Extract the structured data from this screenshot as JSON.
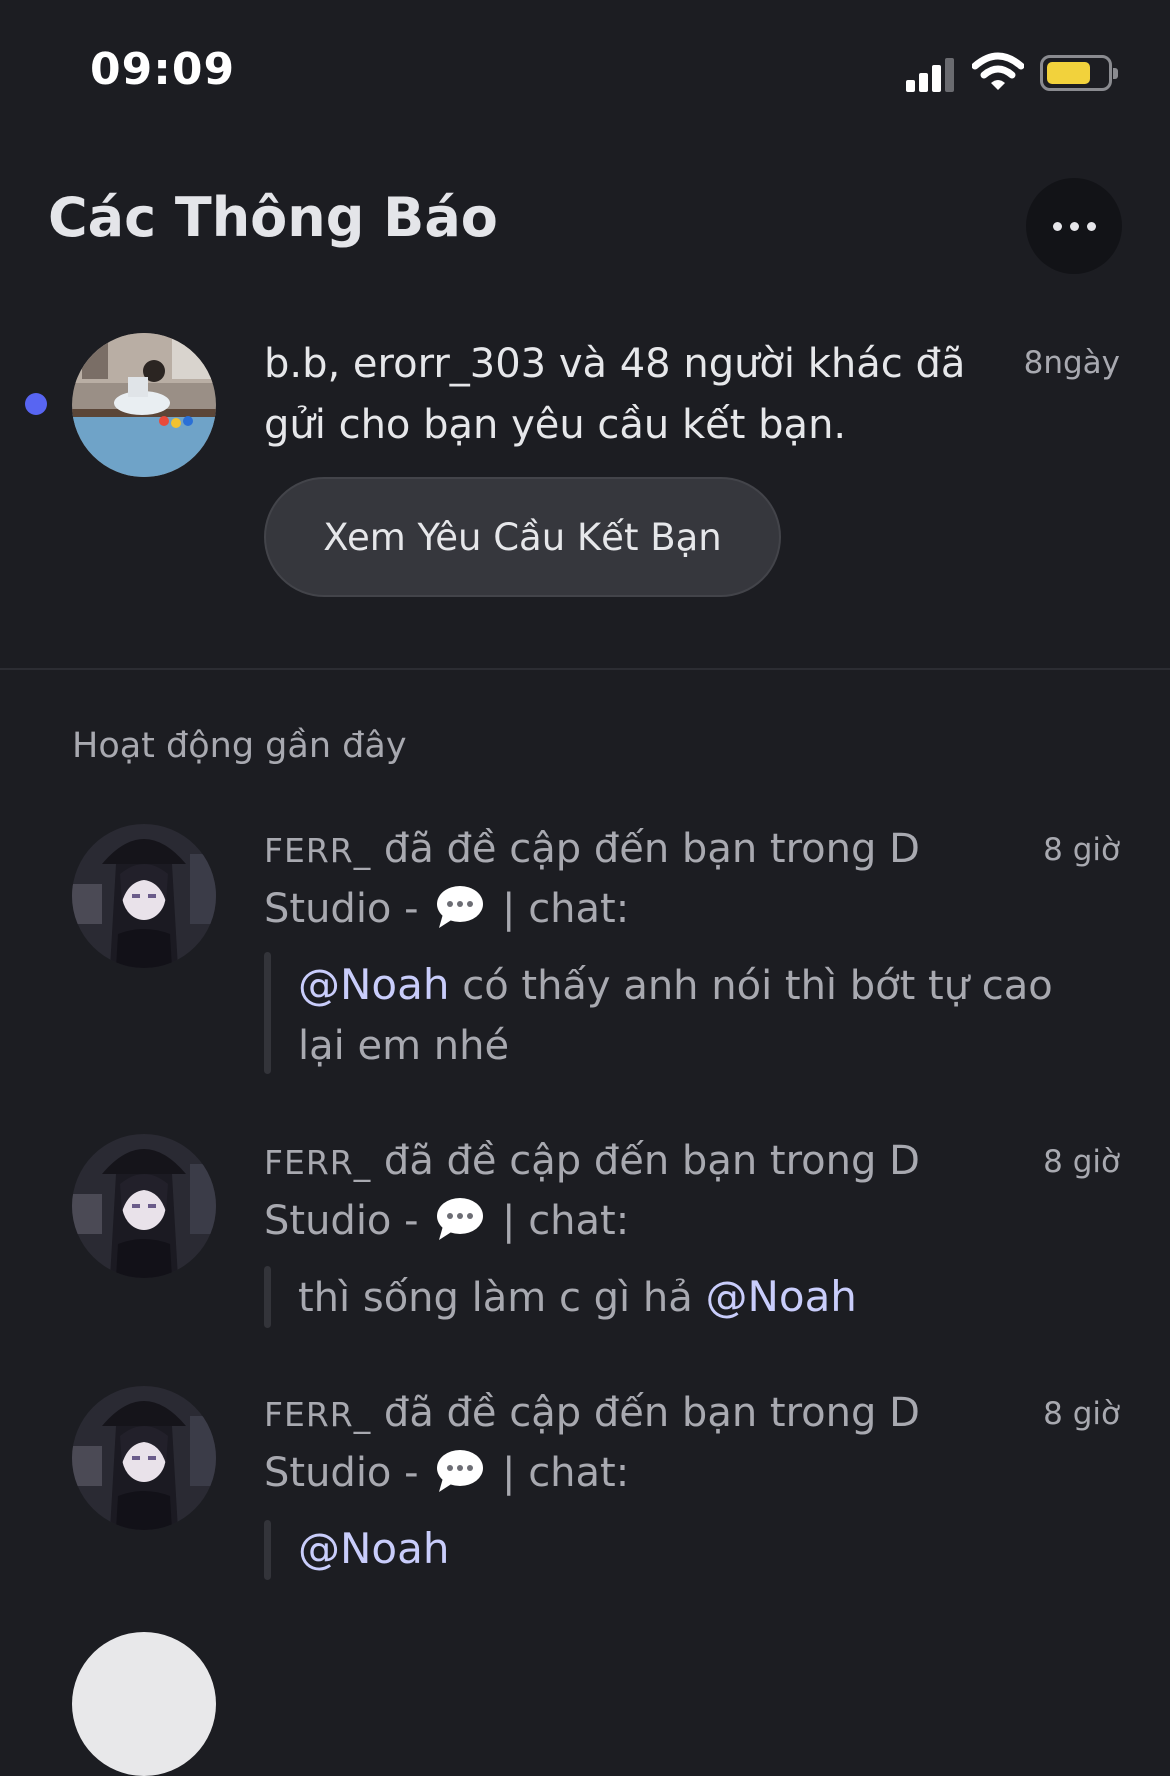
{
  "status_bar": {
    "time": "09:09",
    "battery_level": 0.75
  },
  "header": {
    "title": "Các Thông Báo",
    "more_icon": "ellipsis-icon"
  },
  "friend_requests": {
    "text": "b.b, erorr_303 và 48 người khác đã gửi cho bạn yêu cầu kết bạn.",
    "time": "8ngày",
    "button_label": "Xem Yêu Cầu Kết Bạn",
    "unread_color": "#5865f2"
  },
  "recent": {
    "heading": "Hoạt động gần đây",
    "items": [
      {
        "username": "FERR_",
        "action": "đã đề cập đến bạn trong D Studio -",
        "channel": "| chat:",
        "time": "8 giờ",
        "quote_mention_prefix": "@Noah",
        "quote_text": "có thấy anh nói thì bớt tự cao lại em nhé",
        "quote_mention_suffix": ""
      },
      {
        "username": "FERR_",
        "action": "đã đề cập đến bạn trong D Studio -",
        "channel": "| chat:",
        "time": "8 giờ",
        "quote_mention_prefix": "",
        "quote_text": "thì sống làm c gì hả",
        "quote_mention_suffix": "@Noah"
      },
      {
        "username": "FERR_",
        "action": "đã đề cập đến bạn trong D Studio -",
        "channel": "| chat:",
        "time": "8 giờ",
        "quote_mention_prefix": "@Noah",
        "quote_text": "",
        "quote_mention_suffix": ""
      }
    ]
  },
  "colors": {
    "background": "#1c1d22",
    "mention": "#c9cdfb",
    "button": "#36373d"
  }
}
